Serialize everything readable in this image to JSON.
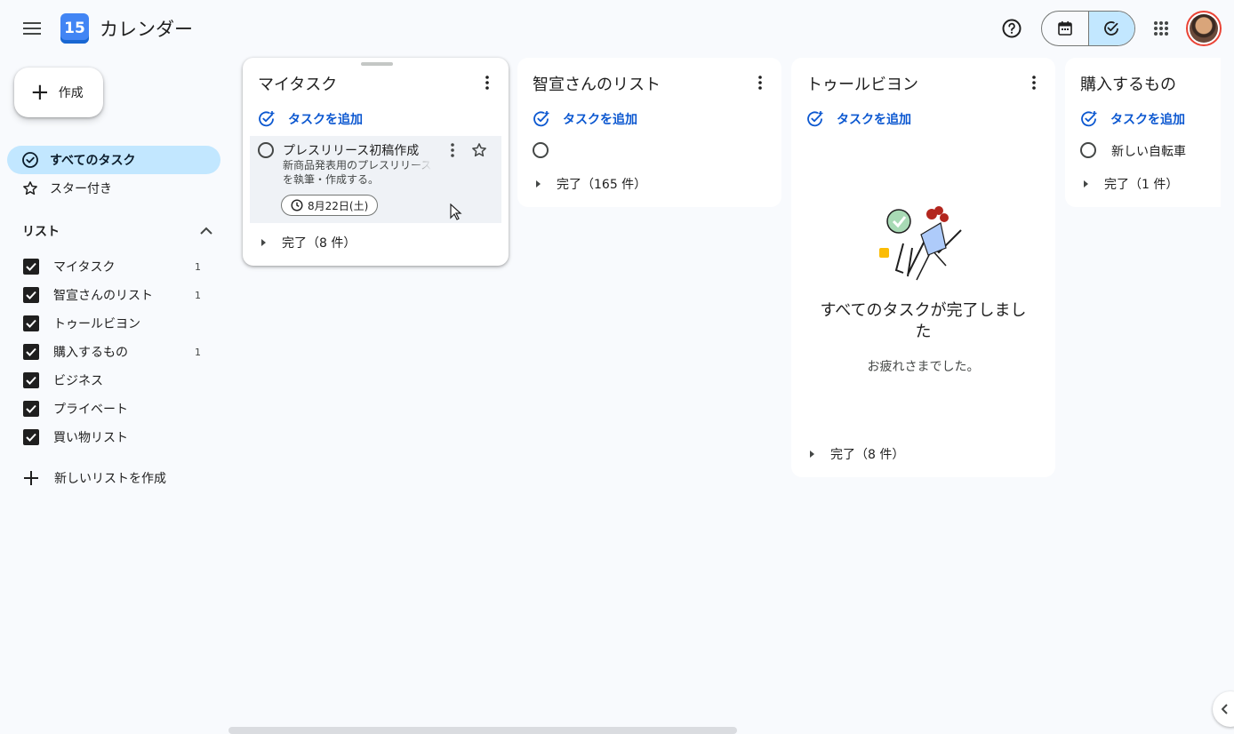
{
  "header": {
    "logo_text": "15",
    "title": "カレンダー",
    "icons": [
      "menu-icon",
      "help-icon",
      "calendar-icon",
      "tasks-check-icon",
      "apps-grid-icon"
    ]
  },
  "sidebar": {
    "create_label": "作成",
    "nav": [
      {
        "label": "すべてのタスク",
        "active": true
      },
      {
        "label": "スター付き",
        "active": false
      }
    ],
    "lists_header": "リスト",
    "lists": [
      {
        "name": "マイタスク",
        "count": "1",
        "checked": true
      },
      {
        "name": "智宣さんのリスト",
        "count": "1",
        "checked": true
      },
      {
        "name": "トゥールビヨン",
        "count": "",
        "checked": true
      },
      {
        "name": "購入するもの",
        "count": "1",
        "checked": true
      },
      {
        "name": "ビジネス",
        "count": "",
        "checked": true
      },
      {
        "name": "プライベート",
        "count": "",
        "checked": true
      },
      {
        "name": "買い物リスト",
        "count": "",
        "checked": true
      }
    ],
    "new_list_label": "新しいリストを作成"
  },
  "boards": {
    "add_task_label": "タスクを追加",
    "mytasks": {
      "title": "マイタスク",
      "task_title": "プレスリリース初稿作成",
      "task_notes_1": "新商品発表用のプレスリリース",
      "task_notes_2": "を執筆・作成する。",
      "task_date": "8月22日(土)",
      "completed": "完了（8 件）"
    },
    "tomonori": {
      "title": "智宣さんのリスト",
      "completed": "完了（165 件）"
    },
    "tourbillon": {
      "title": "トゥールビヨン",
      "empty_title_1": "すべてのタスクが完了しまし",
      "empty_title_2": "た",
      "empty_sub": "お疲れさまでした。",
      "completed": "完了（8 件）"
    },
    "purchase": {
      "title": "購入するもの",
      "task_title": "新しい自転車",
      "completed": "完了（1 件）"
    }
  },
  "colors": {
    "accent": "#0b57d0",
    "active_bg": "#c2e7ff",
    "page_bg": "#f8fafd"
  }
}
